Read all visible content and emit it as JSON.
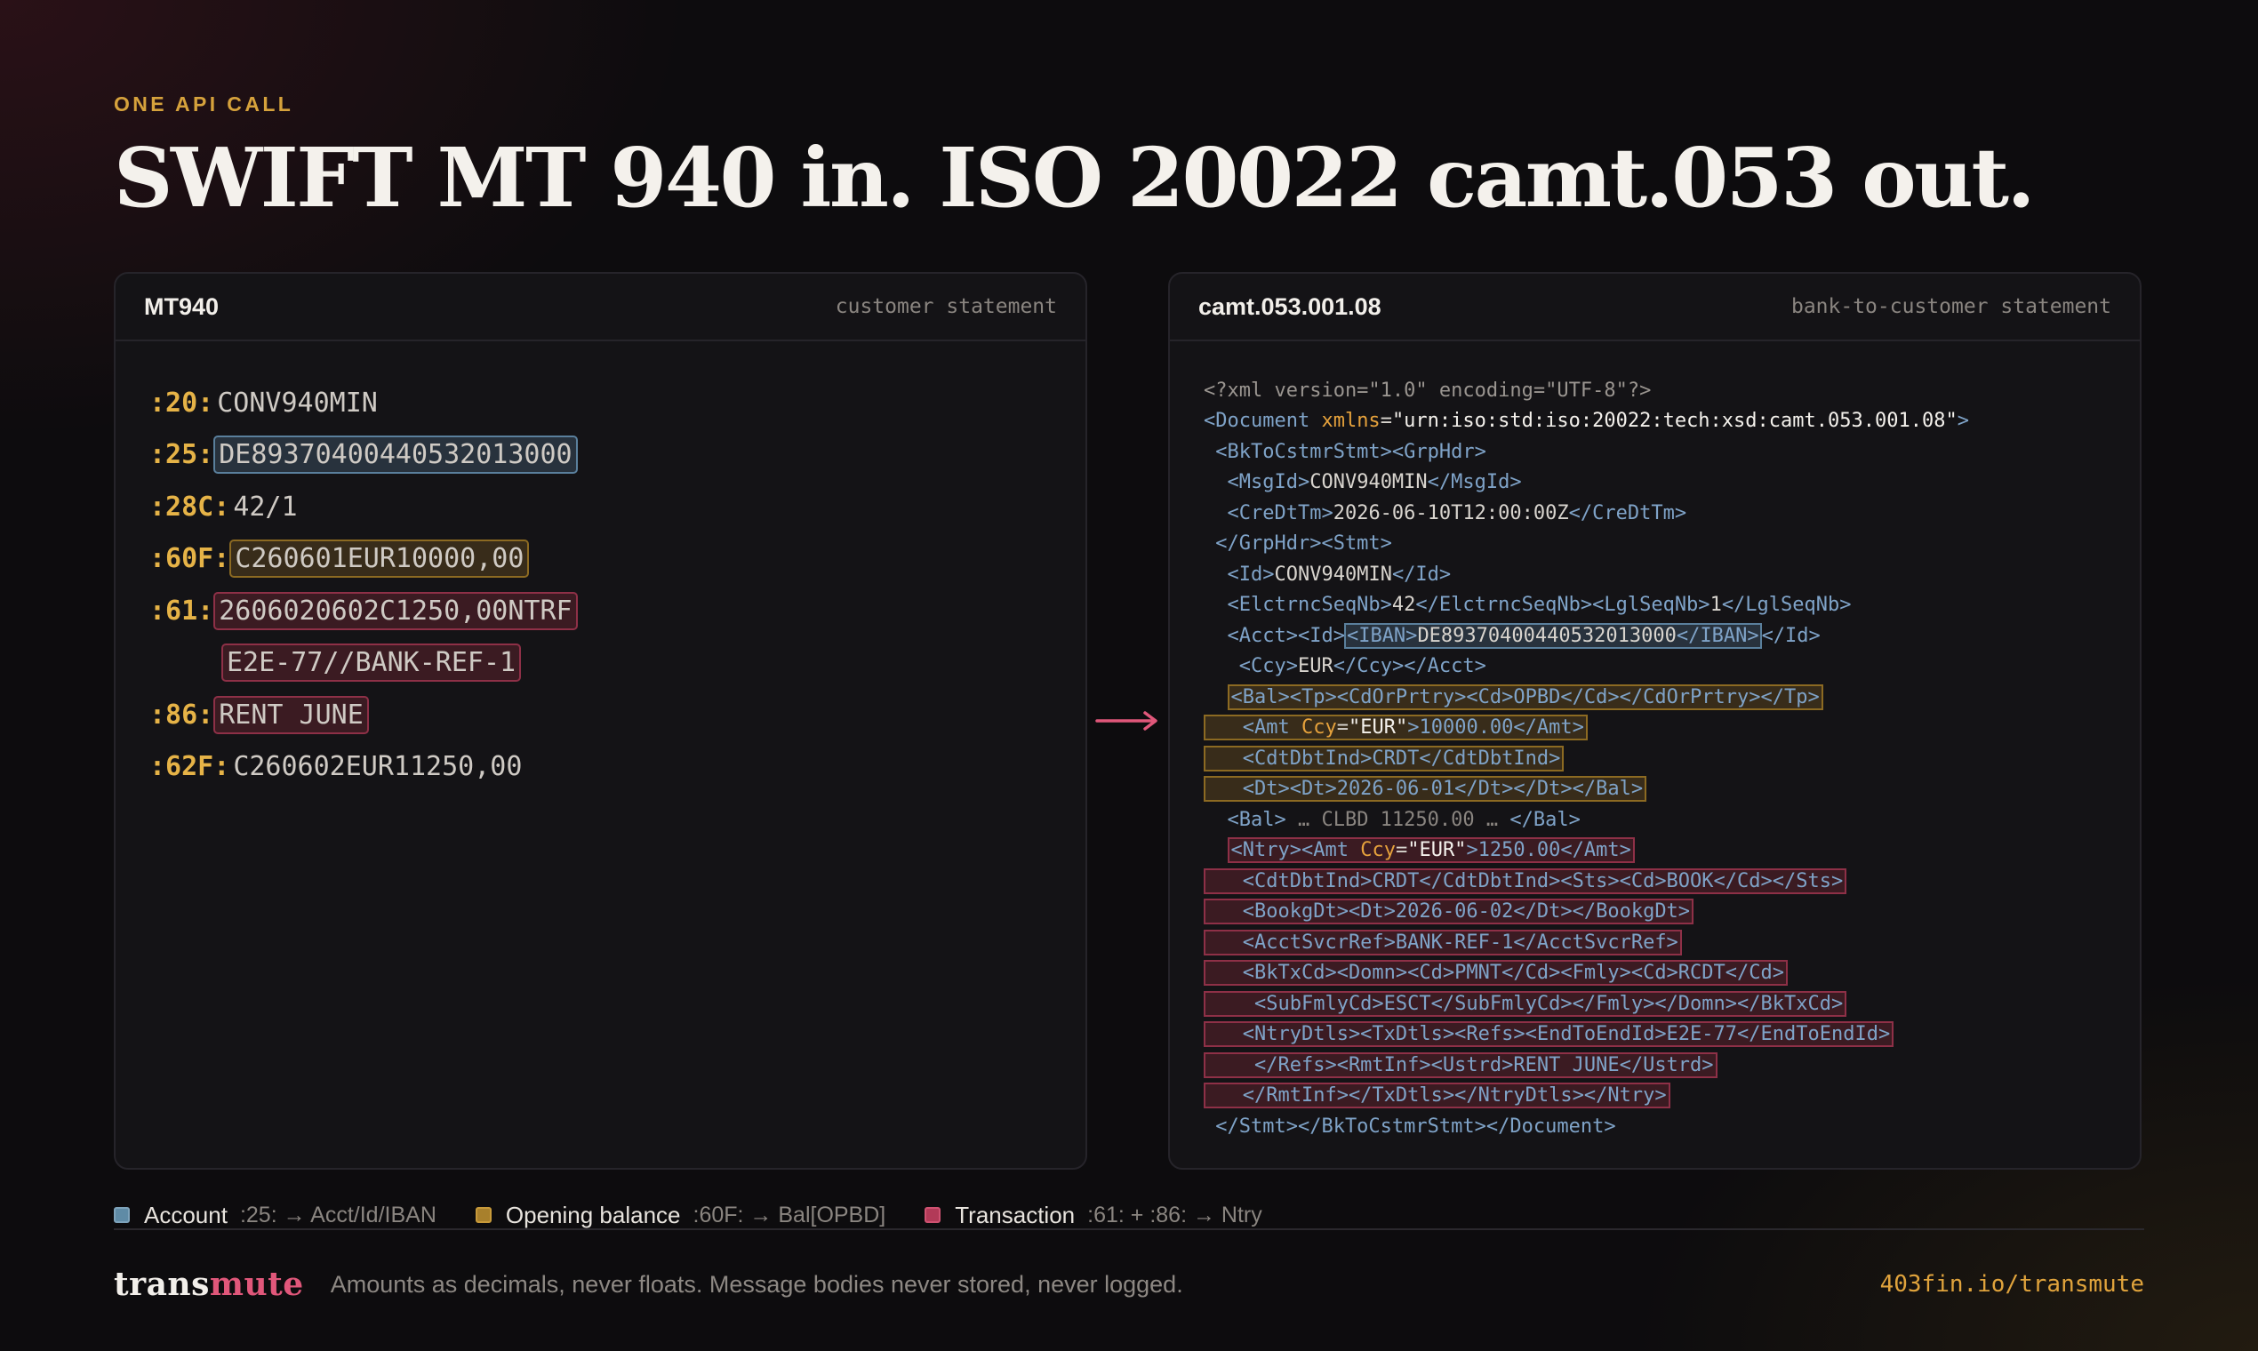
{
  "eyebrow": "ONE API CALL",
  "title": "SWIFT MT 940 in. ISO 20022 camt.053 out.",
  "left_panel": {
    "name": "MT940",
    "subtitle": "customer statement",
    "lines": [
      {
        "tag": ":20:",
        "value": "CONV940MIN",
        "highlight": "none"
      },
      {
        "tag": ":25:",
        "value": "DE89370400440532013000",
        "highlight": "account"
      },
      {
        "tag": ":28C:",
        "value": "42/1",
        "highlight": "none"
      },
      {
        "tag": ":60F:",
        "value": "C260601EUR10000,00",
        "highlight": "opening-balance"
      },
      {
        "tag": ":61:",
        "value": "2606020602C1250,00NTRF",
        "highlight": "transaction"
      },
      {
        "tag": "",
        "value": "E2E-77//BANK-REF-1",
        "highlight": "transaction"
      },
      {
        "tag": ":86:",
        "value": "RENT JUNE",
        "highlight": "transaction"
      },
      {
        "tag": ":62F:",
        "value": "C260602EUR11250,00",
        "highlight": "none"
      }
    ]
  },
  "right_panel": {
    "name": "camt.053.001.08",
    "subtitle": "bank-to-customer statement",
    "xml": {
      "l1": "<?xml version=\"1.0\" encoding=\"UTF-8\"?>",
      "l2_open": "<Document ",
      "l2_attr": "xmlns",
      "l2_eq": "=",
      "l2_str": "\"urn:iso:std:iso:20022:tech:xsd:camt.053.001.08\"",
      "l2_close": ">",
      "l3": " <BkToCstmrStmt><GrpHdr>",
      "l4_a": "  <MsgId>",
      "l4_t": "CONV940MIN",
      "l4_b": "</MsgId>",
      "l5_a": "  <CreDtTm>",
      "l5_t": "2026-06-10T12:00:00Z",
      "l5_b": "</CreDtTm>",
      "l6": " </GrpHdr><Stmt>",
      "l7_a": "  <Id>",
      "l7_t": "CONV940MIN",
      "l7_b": "</Id>",
      "l8_a": "  <ElctrncSeqNb>",
      "l8_t": "42",
      "l8_b": "</ElctrncSeqNb><LglSeqNb>",
      "l8_t2": "1",
      "l8_c": "</LglSeqNb>",
      "l9_a": "  <Acct><Id>",
      "l9_h1": "<IBAN>",
      "l9_t": "DE89370400440532013000",
      "l9_h2": "</IBAN>",
      "l9_b": "</Id>",
      "l10_a": "   <Ccy>",
      "l10_t": "EUR",
      "l10_b": "</Ccy></Acct>",
      "l11_pad": "  ",
      "l11_box": "<Bal><Tp><CdOrPrtry><Cd>OPBD</Cd></CdOrPrtry></Tp>",
      "l12_pad": "   ",
      "l12_a": "<Amt ",
      "l12_attr": "Ccy",
      "l12_eq": "=",
      "l12_str": "\"EUR\"",
      "l12_b": ">10000.00</Amt>",
      "l13": "   <CdtDbtInd>CRDT</CdtDbtInd>",
      "l14": "   <Dt><Dt>2026-06-01</Dt></Dt></Bal>",
      "l15_a": "  <Bal> ",
      "l15_dim": "… CLBD 11250.00 …",
      "l15_b": " </Bal>",
      "l16_pad": "  ",
      "l16_a": "<Ntry><Amt ",
      "l16_attr": "Ccy",
      "l16_eq": "=",
      "l16_str": "\"EUR\"",
      "l16_b": ">1250.00</Amt>",
      "l17": "   <CdtDbtInd>CRDT</CdtDbtInd><Sts><Cd>BOOK</Cd></Sts>",
      "l18": "   <BookgDt><Dt>2026-06-02</Dt></BookgDt>",
      "l19": "   <AcctSvcrRef>BANK-REF-1</AcctSvcrRef>",
      "l20": "   <BkTxCd><Domn><Cd>PMNT</Cd><Fmly><Cd>RCDT</Cd>",
      "l21": "    <SubFmlyCd>ESCT</SubFmlyCd></Fmly></Domn></BkTxCd>",
      "l22": "   <NtryDtls><TxDtls><Refs><EndToEndId>E2E-77</EndToEndId>",
      "l23": "    </Refs><RmtInf><Ustrd>RENT JUNE</Ustrd>",
      "l24": "   </RmtInf></TxDtls></NtryDtls></Ntry>",
      "l25": " </Stmt></BkToCstmrStmt></Document>"
    }
  },
  "arrow_icon": "right-arrow-icon",
  "legend": [
    {
      "label": "Account",
      "mapping": ":25: → Acct/Id/IBAN",
      "color": "#5f8ba6"
    },
    {
      "label": "Opening balance",
      "mapping": ":60F: → Bal[OPBD]",
      "color": "#a8802c"
    },
    {
      "label": "Transaction",
      "mapping": ":61: + :86: → Ntry",
      "color": "#b23a58"
    }
  ],
  "footer": {
    "brand_a": "trans",
    "brand_b": "mute",
    "tagline": "Amounts as decimals, never floats. Message bodies never stored, never logged.",
    "url": "403fin.io/transmute"
  },
  "colors": {
    "accent_gold": "#d6a23c",
    "accent_pink": "#e0577a",
    "account": "#5f8ba6",
    "opening_balance": "#a8802c",
    "transaction": "#b23a58"
  }
}
